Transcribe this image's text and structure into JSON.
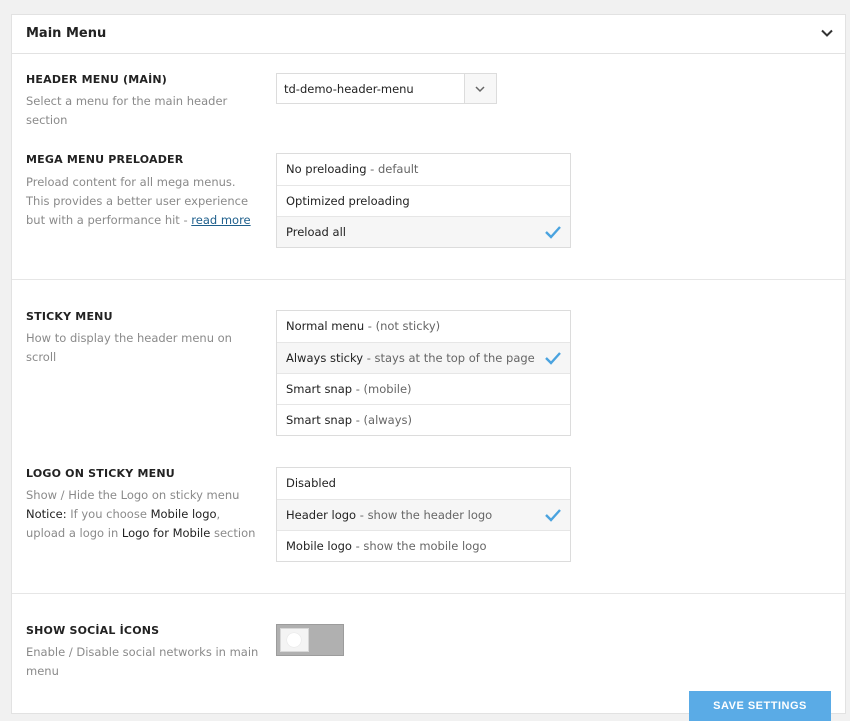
{
  "panel": {
    "title": "Main Menu"
  },
  "header_menu": {
    "title": "HEADER MENU (MAİN)",
    "description": "Select a menu for the main header section",
    "selected": "td-demo-header-menu"
  },
  "mega_menu_preloader": {
    "title": "MEGA MENU PRELOADER",
    "description": "Preload content for all mega menus. This provides a better user experience but with a performance hit - ",
    "link": "read more",
    "options": [
      {
        "label": "No preloading",
        "sub": " - default",
        "selected": false
      },
      {
        "label": "Optimized preloading",
        "sub": "",
        "selected": false
      },
      {
        "label": "Preload all",
        "sub": "",
        "selected": true
      }
    ]
  },
  "sticky_menu": {
    "title": "STICKY MENU",
    "description": "How to display the header menu on scroll",
    "options": [
      {
        "label": "Normal menu",
        "sub": " - (not sticky)",
        "selected": false
      },
      {
        "label": "Always sticky",
        "sub": " - stays at the top of the page",
        "selected": true
      },
      {
        "label": "Smart snap",
        "sub": " - (mobile)",
        "selected": false
      },
      {
        "label": "Smart snap",
        "sub": " - (always)",
        "selected": false
      }
    ]
  },
  "logo_sticky": {
    "title": "LOGO ON STICKY MENU",
    "desc_line1": "Show / Hide the Logo on sticky menu",
    "notice_label": "Notice:",
    "notice_text1": " If you choose ",
    "notice_mobile_logo": "Mobile logo",
    "notice_text2": ", upload a logo in ",
    "notice_logo_for_mobile": "Logo for Mobile",
    "notice_text3": " section",
    "options": [
      {
        "label": "Disabled",
        "sub": "",
        "selected": false
      },
      {
        "label": "Header logo",
        "sub": " - show the header logo",
        "selected": true
      },
      {
        "label": "Mobile logo",
        "sub": " - show the mobile logo",
        "selected": false
      }
    ]
  },
  "social_icons": {
    "title": "SHOW SOCİAL İCONS",
    "description": "Enable / Disable social networks in main menu",
    "enabled": false
  },
  "save_button": {
    "label": "SAVE SETTINGS"
  },
  "colors": {
    "accent": "#4aa3df",
    "check": "#4aa3df"
  }
}
